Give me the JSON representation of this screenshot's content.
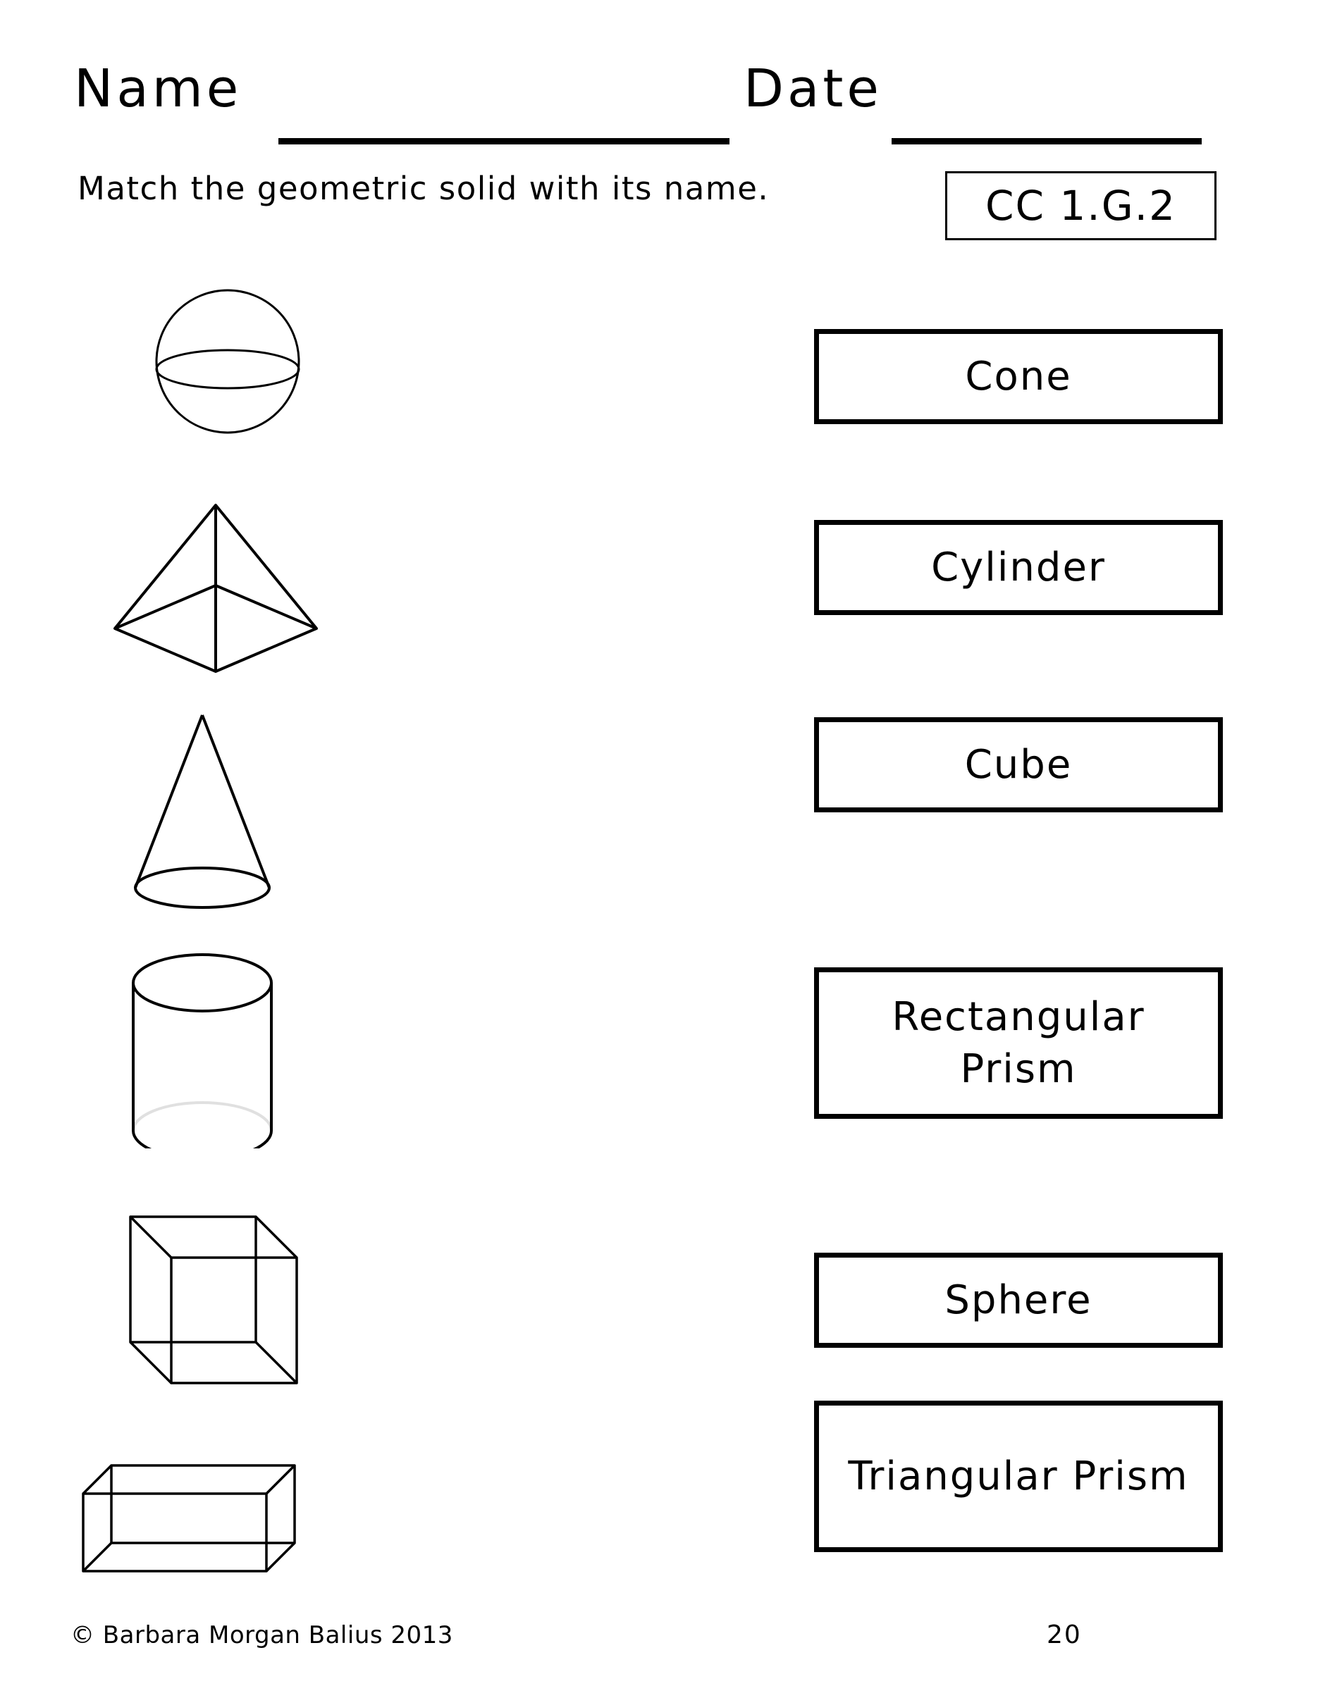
{
  "header": {
    "name_label": "Name",
    "date_label": "Date",
    "instruction": "Match the geometric solid with its name.",
    "standard_code": "CC 1.G.2"
  },
  "shapes": [
    {
      "name": "sphere",
      "icon": "sphere-shape"
    },
    {
      "name": "square-pyramid",
      "icon": "pyramid-shape"
    },
    {
      "name": "cone",
      "icon": "cone-shape"
    },
    {
      "name": "cylinder",
      "icon": "cylinder-shape"
    },
    {
      "name": "cube",
      "icon": "cube-shape"
    },
    {
      "name": "rectangular-prism",
      "icon": "rectangular-prism-shape"
    }
  ],
  "answers": [
    {
      "label": "Cone"
    },
    {
      "label": "Cylinder"
    },
    {
      "label": "Cube"
    },
    {
      "label": "Rectangular Prism"
    },
    {
      "label": "Sphere"
    },
    {
      "label": "Triangular Prism"
    }
  ],
  "footer": {
    "copyright": "© Barbara Morgan Balius 2013",
    "page_number": "20"
  },
  "colors": {
    "ink": "#000000",
    "paper": "#ffffff"
  }
}
